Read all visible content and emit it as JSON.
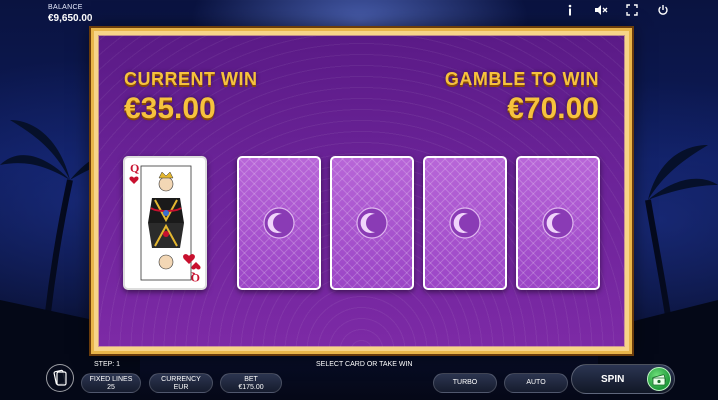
{
  "balance": {
    "label": "BALANCE",
    "value": "€9,650.00"
  },
  "top_icons": [
    "info-icon",
    "sound-off-icon",
    "fullscreen-icon",
    "power-icon"
  ],
  "current_win": {
    "label": "CURRENT WIN",
    "value": "€35.00"
  },
  "gamble_to_win": {
    "label": "GAMBLE TO WIN",
    "value": "€70.00"
  },
  "dealer_card": {
    "rank": "Q",
    "suit": "hearts"
  },
  "hidden_cards": 4,
  "footer": {
    "step": "STEP: 1",
    "hint": "SELECT CARD OR TAKE WIN",
    "fixed_lines": {
      "label": "FIXED LINES",
      "value": "25"
    },
    "currency": {
      "label": "CURRENCY",
      "value": "EUR"
    },
    "bet": {
      "label": "BET",
      "value": "€175.00"
    },
    "turbo": "TURBO",
    "auto": "AUTO",
    "spin": "SPIN"
  },
  "colors": {
    "gold": "#f6c23e",
    "purple": "#6b2398",
    "card_back": "#a955cf",
    "spin_green": "#2fb34a"
  }
}
